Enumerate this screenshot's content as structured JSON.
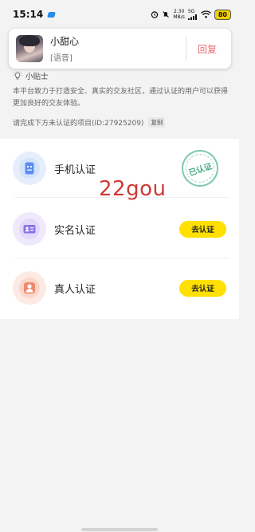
{
  "status_bar": {
    "time": "15:14",
    "net_speed_value": "2.30",
    "net_speed_unit": "MB/s",
    "network": "5G",
    "battery": "80"
  },
  "notification": {
    "name": "小甜心",
    "message": "[语音]",
    "reply_label": "回复"
  },
  "tips": {
    "title": "小贴士",
    "body": "本平台致力于打造安全、真实的交友社区，通过认证的用户可以获得更加良好的交友体验。",
    "pending": "请完成下方未认证的项目(ID:27925209)",
    "copy_label": "复制"
  },
  "verifications": [
    {
      "label": "手机认证",
      "status": "已认证",
      "icon": "phone-icon",
      "color": "#5b8def"
    },
    {
      "label": "实名认证",
      "action": "去认证",
      "icon": "id-card-icon",
      "color": "#8b72e6"
    },
    {
      "label": "真人认证",
      "action": "去认证",
      "icon": "person-icon",
      "color": "#f0886a"
    }
  ],
  "watermark": "22gou",
  "colors": {
    "accent_yellow": "#ffe000",
    "reply_pink": "#e86b72",
    "verified_green": "#4daa85"
  }
}
